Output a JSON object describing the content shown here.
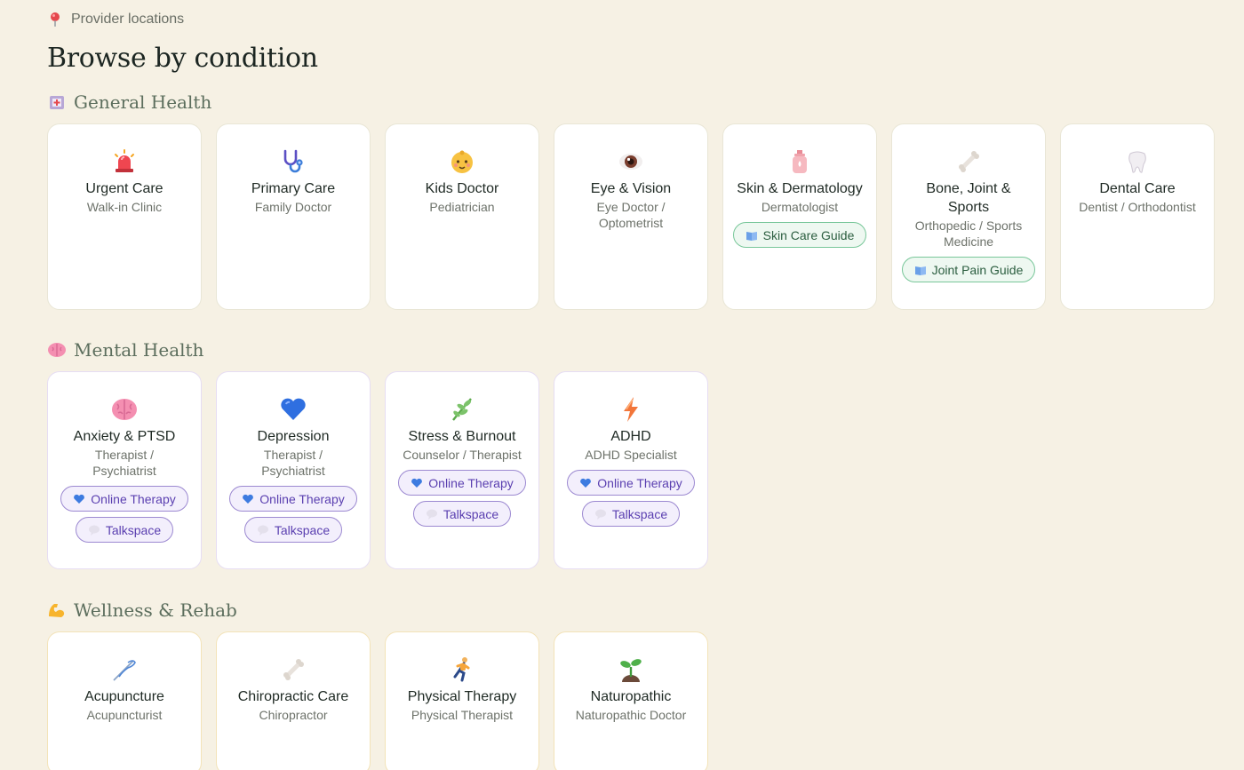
{
  "breadcrumb": {
    "label": "Provider locations",
    "icon": "pin-icon"
  },
  "page": {
    "title": "Browse by condition"
  },
  "colors": {
    "background": "#f6f1e4",
    "heading": "#1c2622",
    "section": "#5c6e5d",
    "green_pill": "#79c79a",
    "purple_pill": "#9c89d1"
  },
  "sections": [
    {
      "title": "General Health",
      "icon": "hospital-icon",
      "cards": [
        {
          "name": "Urgent Care",
          "sub": "Walk-in Clinic",
          "icon": "siren-icon"
        },
        {
          "name": "Primary Care",
          "sub": "Family Doctor",
          "icon": "stethoscope-icon"
        },
        {
          "name": "Kids Doctor",
          "sub": "Pediatrician",
          "icon": "baby-icon"
        },
        {
          "name": "Eye & Vision",
          "sub": "Eye Doctor / Optometrist",
          "icon": "eye-icon"
        },
        {
          "name": "Skin & Dermatology",
          "sub": "Dermatologist",
          "icon": "lotion-icon",
          "pills": [
            {
              "label": "Skin Care Guide",
              "icon": "book-icon"
            }
          ]
        },
        {
          "name": "Bone, Joint & Sports",
          "sub": "Orthopedic / Sports Medicine",
          "icon": "bone-icon",
          "pills": [
            {
              "label": "Joint Pain Guide",
              "icon": "book-icon"
            }
          ]
        },
        {
          "name": "Dental Care",
          "sub": "Dentist / Orthodontist",
          "icon": "tooth-icon"
        }
      ]
    },
    {
      "title": "Mental Health",
      "icon": "brain-icon",
      "cards": [
        {
          "name": "Anxiety & PTSD",
          "sub": "Therapist / Psychiatrist",
          "icon": "brain-icon",
          "pills": [
            {
              "label": "Online Therapy",
              "icon": "heart-icon"
            },
            {
              "label": "Talkspace",
              "icon": "speech-bubble-icon"
            }
          ]
        },
        {
          "name": "Depression",
          "sub": "Therapist / Psychiatrist",
          "icon": "blue-heart-icon",
          "pills": [
            {
              "label": "Online Therapy",
              "icon": "heart-icon"
            },
            {
              "label": "Talkspace",
              "icon": "speech-bubble-icon"
            }
          ]
        },
        {
          "name": "Stress & Burnout",
          "sub": "Counselor / Therapist",
          "icon": "herb-icon",
          "pills": [
            {
              "label": "Online Therapy",
              "icon": "heart-icon"
            },
            {
              "label": "Talkspace",
              "icon": "speech-bubble-icon"
            }
          ]
        },
        {
          "name": "ADHD",
          "sub": "ADHD Specialist",
          "icon": "lightning-icon",
          "pills": [
            {
              "label": "Online Therapy",
              "icon": "heart-icon"
            },
            {
              "label": "Talkspace",
              "icon": "speech-bubble-icon"
            }
          ]
        }
      ]
    },
    {
      "title": "Wellness & Rehab",
      "icon": "flexed-arm-icon",
      "cards": [
        {
          "name": "Acupuncture",
          "sub": "Acupuncturist",
          "icon": "needle-icon"
        },
        {
          "name": "Chiropractic Care",
          "sub": "Chiropractor",
          "icon": "bone-icon"
        },
        {
          "name": "Physical Therapy",
          "sub": "Physical Therapist",
          "icon": "runner-icon"
        },
        {
          "name": "Naturopathic",
          "sub": "Naturopathic Doctor",
          "icon": "seedling-icon"
        }
      ]
    }
  ]
}
